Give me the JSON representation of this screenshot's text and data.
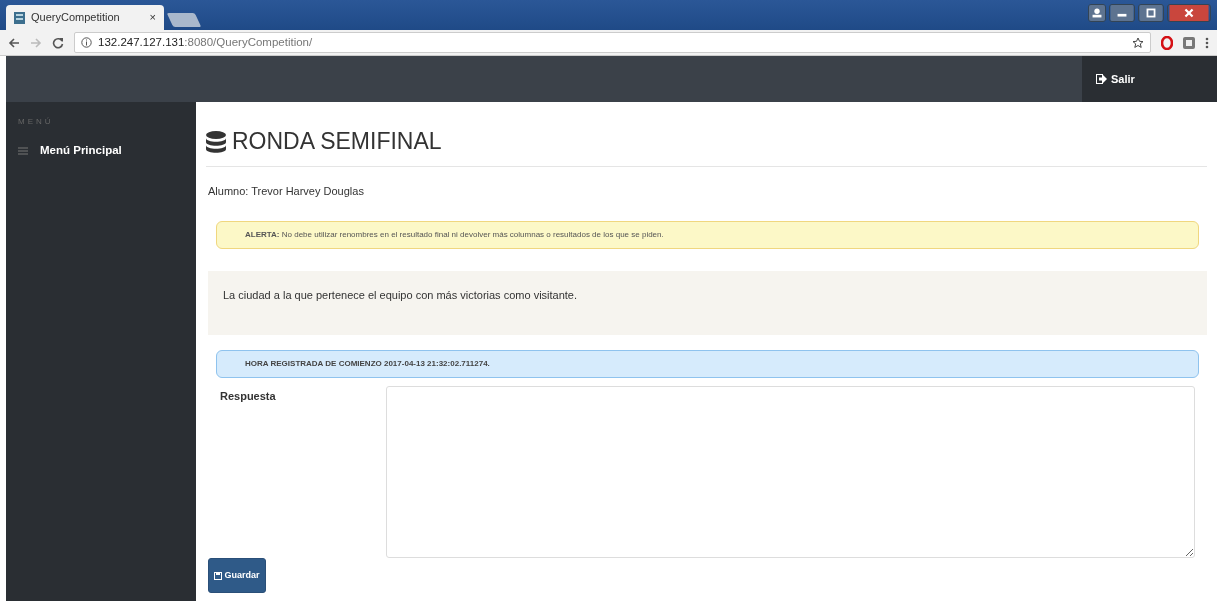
{
  "browser": {
    "tab_title": "QueryCompetition",
    "tab_close": "×",
    "url_host": "132.247.127.131",
    "url_rest": ":8080/QueryCompetition/"
  },
  "header": {
    "logout": "Salir"
  },
  "sidebar": {
    "heading": "MENÚ",
    "items": [
      {
        "label": "Menú Principal"
      }
    ]
  },
  "page": {
    "title": "RONDA SEMIFINAL",
    "student": "Alumno: Trevor Harvey Douglas",
    "alerts": [
      {
        "kind": "warning",
        "text": "**ALERTA:** No debe utilizar renombres en el resultado final ni devolver más columnas o resultados de los que se piden."
      }
    ],
    "question": "La ciudad a la que pertenece el equipo con más victorias como visitante.",
    "start_notice": "HORA REGISTRADA DE COMIENZO 2017-04-13 21:32:02.711274.",
    "answer_label": "Respuesta",
    "save_button": "Guardar"
  }
}
